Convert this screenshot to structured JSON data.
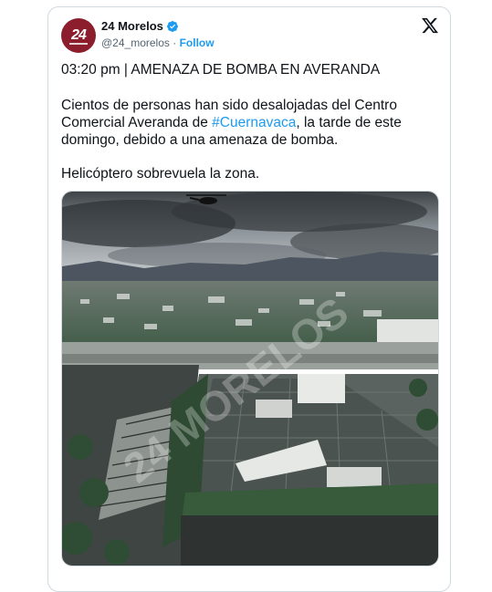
{
  "account": {
    "avatar_text": "24",
    "name": "24 Morelos",
    "handle": "@24_morelos",
    "separator": "·",
    "follow_label": "Follow"
  },
  "post": {
    "headline": "03:20 pm | AMENAZA DE BOMBA EN AVERANDA",
    "body_before": "Cientos de personas han sido desalojadas del Centro Comercial Averanda de ",
    "hashtag": "#Cuernavaca",
    "body_after": ", la tarde de este domingo, debido a una amenaza de bomba.",
    "body2": "Helicóptero sobrevuela la zona.",
    "watermark": "24 MORELOS"
  },
  "icons": {
    "verified": "verified-badge-icon",
    "logo": "x-logo-icon"
  },
  "colors": {
    "link": "#1d9bf0",
    "avatar_bg": "#8b1d2c",
    "border": "#cfd9de"
  }
}
